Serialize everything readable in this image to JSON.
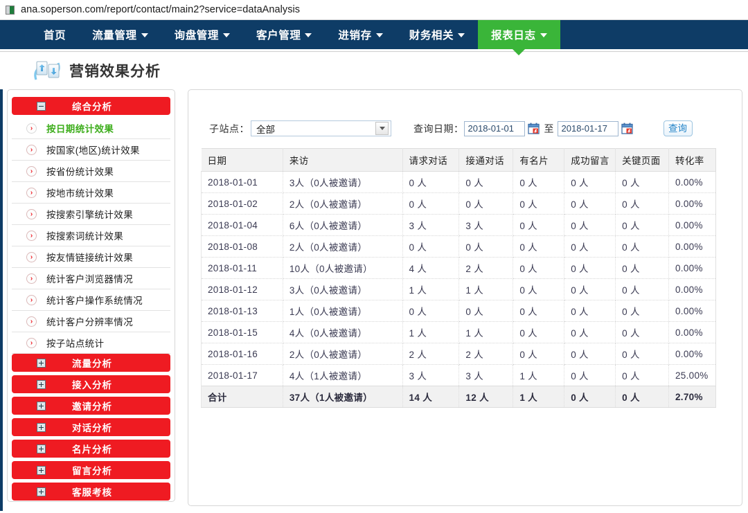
{
  "browser": {
    "url": "ana.soperson.com/report/contact/main2?service=dataAnalysis",
    "favicon": "page-favicon"
  },
  "nav": {
    "items": [
      {
        "label": "首页",
        "caret": false,
        "active": false
      },
      {
        "label": "流量管理",
        "caret": true,
        "active": false
      },
      {
        "label": "询盘管理",
        "caret": true,
        "active": false
      },
      {
        "label": "客户管理",
        "caret": true,
        "active": false
      },
      {
        "label": "进销存",
        "caret": true,
        "active": false
      },
      {
        "label": "财务相关",
        "caret": true,
        "active": false
      },
      {
        "label": "报表日志",
        "caret": true,
        "active": true
      }
    ],
    "bg_color": "#0e3c66",
    "active_color": "#3ab539"
  },
  "header": {
    "title": "营销效果分析",
    "icon": "sync-documents-icon"
  },
  "sidebar": {
    "sections": [
      {
        "label": "综合分析",
        "expanded": true,
        "items": [
          {
            "label": "按日期统计效果",
            "active": true
          },
          {
            "label": "按国家(地区)统计效果",
            "active": false
          },
          {
            "label": "按省份统计效果",
            "active": false
          },
          {
            "label": "按地市统计效果",
            "active": false
          },
          {
            "label": "按搜索引擎统计效果",
            "active": false
          },
          {
            "label": "按搜索词统计效果",
            "active": false
          },
          {
            "label": "按友情链接统计效果",
            "active": false
          },
          {
            "label": "统计客户浏览器情况",
            "active": false
          },
          {
            "label": "统计客户操作系统情况",
            "active": false
          },
          {
            "label": "统计客户分辨率情况",
            "active": false
          },
          {
            "label": "按子站点统计",
            "active": false
          }
        ]
      },
      {
        "label": "流量分析",
        "expanded": false,
        "items": []
      },
      {
        "label": "接入分析",
        "expanded": false,
        "items": []
      },
      {
        "label": "邀请分析",
        "expanded": false,
        "items": []
      },
      {
        "label": "对话分析",
        "expanded": false,
        "items": []
      },
      {
        "label": "名片分析",
        "expanded": false,
        "items": []
      },
      {
        "label": "留言分析",
        "expanded": false,
        "items": []
      },
      {
        "label": "客服考核",
        "expanded": false,
        "items": []
      }
    ],
    "accent_color": "#ef1b22",
    "active_color": "#3fae1e"
  },
  "filters": {
    "subsite_label": "子站点：",
    "subsite_value": "全部",
    "date_label": "查询日期：",
    "date_from": "2018-01-01",
    "date_to": "2018-01-17",
    "between_word": "至",
    "query_button": "查询",
    "calendar_icon": "calendar-icon",
    "dropdown_icon": "chevron-down-icon"
  },
  "table": {
    "columns": [
      "日期",
      "来访",
      "请求对话",
      "接通对话",
      "有名片",
      "成功留言",
      "关键页面",
      "转化率"
    ],
    "rows": [
      [
        "2018-01-01",
        "3人（0人被邀请）",
        "0 人",
        "0 人",
        "0 人",
        "0 人",
        "0 人",
        "0.00%"
      ],
      [
        "2018-01-02",
        "2人（0人被邀请）",
        "0 人",
        "0 人",
        "0 人",
        "0 人",
        "0 人",
        "0.00%"
      ],
      [
        "2018-01-04",
        "6人（0人被邀请）",
        "3 人",
        "3 人",
        "0 人",
        "0 人",
        "0 人",
        "0.00%"
      ],
      [
        "2018-01-08",
        "2人（0人被邀请）",
        "0 人",
        "0 人",
        "0 人",
        "0 人",
        "0 人",
        "0.00%"
      ],
      [
        "2018-01-11",
        "10人（0人被邀请）",
        "4 人",
        "2 人",
        "0 人",
        "0 人",
        "0 人",
        "0.00%"
      ],
      [
        "2018-01-12",
        "3人（0人被邀请）",
        "1 人",
        "1 人",
        "0 人",
        "0 人",
        "0 人",
        "0.00%"
      ],
      [
        "2018-01-13",
        "1人（0人被邀请）",
        "0 人",
        "0 人",
        "0 人",
        "0 人",
        "0 人",
        "0.00%"
      ],
      [
        "2018-01-15",
        "4人（0人被邀请）",
        "1 人",
        "1 人",
        "0 人",
        "0 人",
        "0 人",
        "0.00%"
      ],
      [
        "2018-01-16",
        "2人（0人被邀请）",
        "2 人",
        "2 人",
        "0 人",
        "0 人",
        "0 人",
        "0.00%"
      ],
      [
        "2018-01-17",
        "4人（1人被邀请）",
        "3 人",
        "3 人",
        "1 人",
        "0 人",
        "0 人",
        "25.00%"
      ]
    ],
    "total_row": [
      "合计",
      "37人（1人被邀请）",
      "14 人",
      "12 人",
      "1 人",
      "0 人",
      "0 人",
      "2.70%"
    ]
  }
}
